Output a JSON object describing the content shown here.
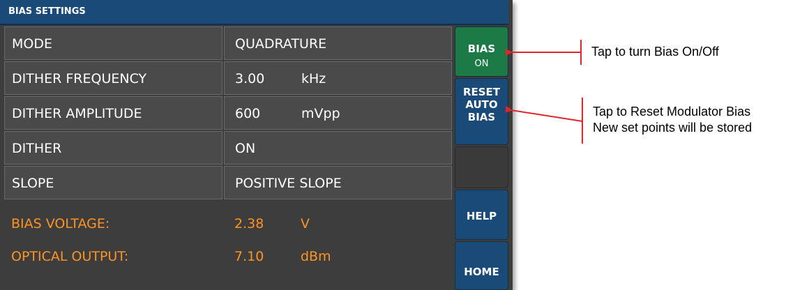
{
  "panel": {
    "title": "BIAS SETTINGS",
    "rows": [
      {
        "label": "MODE",
        "value": "QUADRATURE",
        "unit": ""
      },
      {
        "label": "DITHER FREQUENCY",
        "value": "3.00",
        "unit": "kHz"
      },
      {
        "label": "DITHER AMPLITUDE",
        "value": "600",
        "unit": "mVpp"
      },
      {
        "label": "DITHER",
        "value": "ON",
        "unit": ""
      },
      {
        "label": "SLOPE",
        "value": "POSITIVE SLOPE",
        "unit": ""
      }
    ],
    "readouts": [
      {
        "label": "BIAS VOLTAGE:",
        "value": "2.38",
        "unit": "V"
      },
      {
        "label": "OPTICAL OUTPUT:",
        "value": "7.10",
        "unit": "dBm"
      }
    ],
    "readout_color": "#ff9324"
  },
  "buttons": {
    "bias": {
      "line1": "BIAS",
      "line2": "ON",
      "color": "#1b7a46"
    },
    "reset": {
      "line1": "RESET",
      "line2": "AUTO",
      "line3": "BIAS",
      "color": "#1a4a78"
    },
    "help": {
      "label": "HELP"
    },
    "home": {
      "label": "HOME"
    }
  },
  "annotations": {
    "bias_note": "Tap to turn Bias On/Off",
    "reset_note_line1": "Tap to Reset Modulator Bias",
    "reset_note_line2": "New set points will be stored",
    "arrow_color": "#e0262a"
  }
}
